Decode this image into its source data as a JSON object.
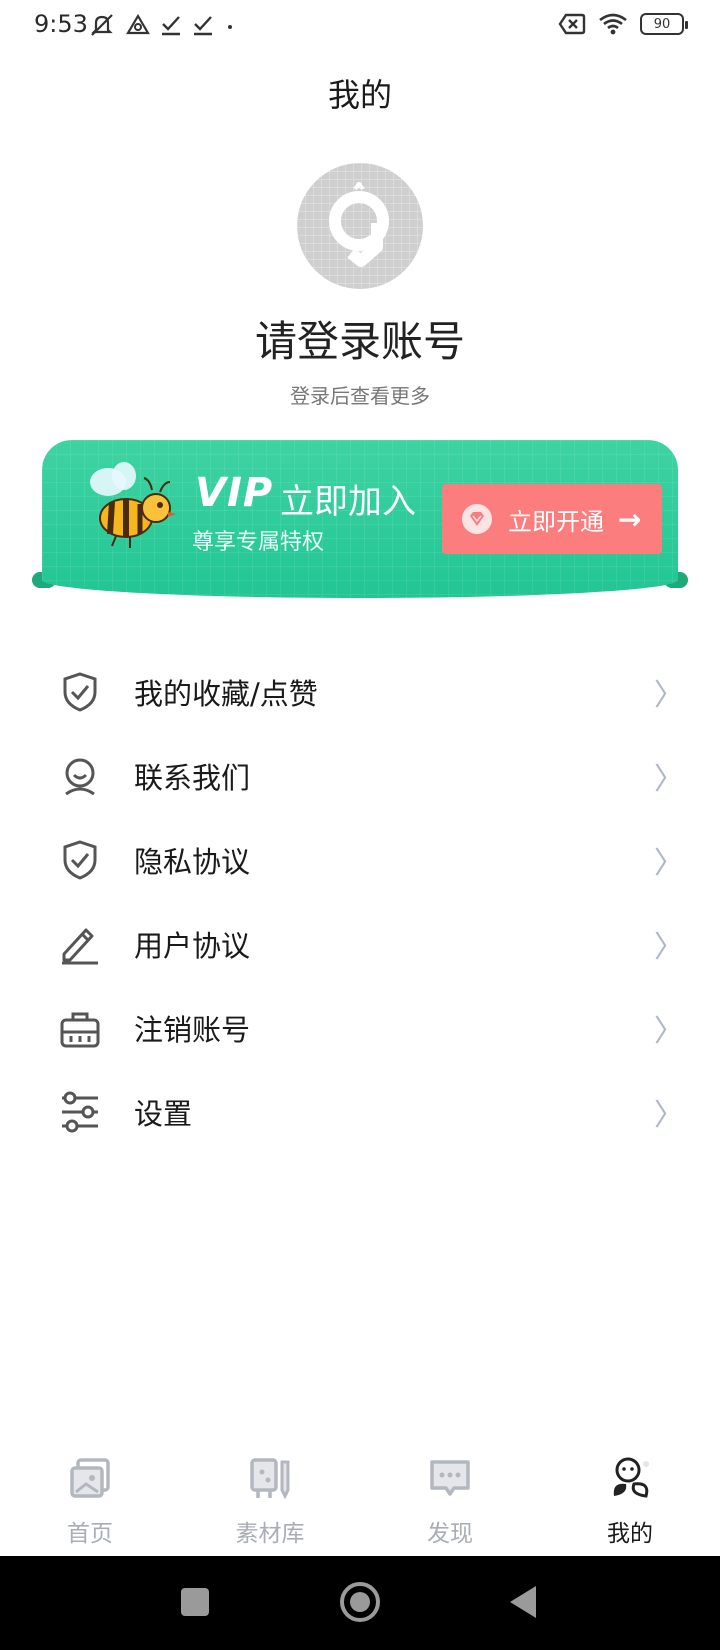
{
  "status_bar": {
    "time": "9:53",
    "battery": "90",
    "icons": [
      "mute-icon",
      "vpn-icon",
      "check-icon",
      "check-icon",
      "dot-icon",
      "no-sim-icon",
      "wifi-icon",
      "battery-icon"
    ]
  },
  "header": {
    "title": "我的"
  },
  "profile": {
    "title": "请登录账号",
    "subtitle": "登录后查看更多"
  },
  "vip": {
    "badge": "VIP",
    "title": "立即加入",
    "subtitle": "尊享专属特权",
    "button_label": "立即开通",
    "colors": {
      "banner": "#2ecb9b",
      "button": "#fb7d7d"
    }
  },
  "menu": {
    "items": [
      {
        "label": "我的收藏/点赞",
        "icon": "shield-check-icon"
      },
      {
        "label": "联系我们",
        "icon": "contact-icon"
      },
      {
        "label": "隐私协议",
        "icon": "shield-check-icon"
      },
      {
        "label": "用户协议",
        "icon": "pencil-icon"
      },
      {
        "label": "注销账号",
        "icon": "briefcase-icon"
      },
      {
        "label": "设置",
        "icon": "sliders-icon"
      }
    ],
    "chevron": "〉"
  },
  "tabs": [
    {
      "label": "首页",
      "icon": "home-icon",
      "active": false
    },
    {
      "label": "素材库",
      "icon": "library-icon",
      "active": false
    },
    {
      "label": "发现",
      "icon": "discover-icon",
      "active": false
    },
    {
      "label": "我的",
      "icon": "profile-icon",
      "active": true
    }
  ]
}
